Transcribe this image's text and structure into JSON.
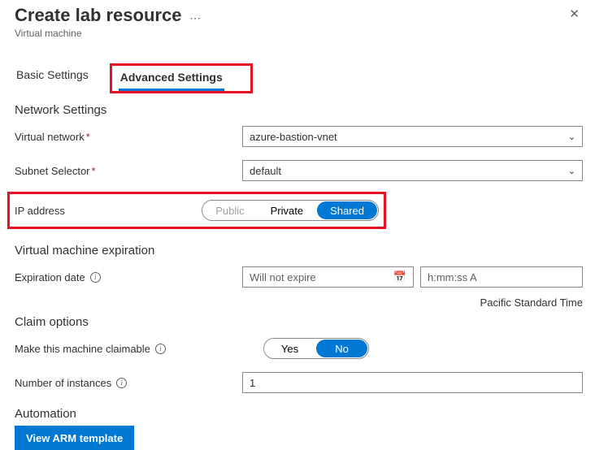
{
  "header": {
    "title": "Create lab resource",
    "subtitle": "Virtual machine"
  },
  "tabs": {
    "basic": "Basic Settings",
    "advanced": "Advanced Settings"
  },
  "sections": {
    "network": "Network Settings",
    "vmexpiration": "Virtual machine expiration",
    "claim": "Claim options",
    "automation": "Automation"
  },
  "fields": {
    "vnet_label": "Virtual network",
    "vnet_value": "azure-bastion-vnet",
    "subnet_label": "Subnet Selector",
    "subnet_value": "default",
    "ip_label": "IP address",
    "ip_public": "Public",
    "ip_private": "Private",
    "ip_shared": "Shared",
    "exp_label": "Expiration date",
    "exp_placeholder": "Will not expire",
    "time_placeholder": "h:mm:ss A",
    "timezone": "Pacific Standard Time",
    "claimable_label": "Make this machine claimable",
    "claim_yes": "Yes",
    "claim_no": "No",
    "instances_label": "Number of instances",
    "instances_value": "1"
  },
  "buttons": {
    "view_arm": "View ARM template"
  }
}
